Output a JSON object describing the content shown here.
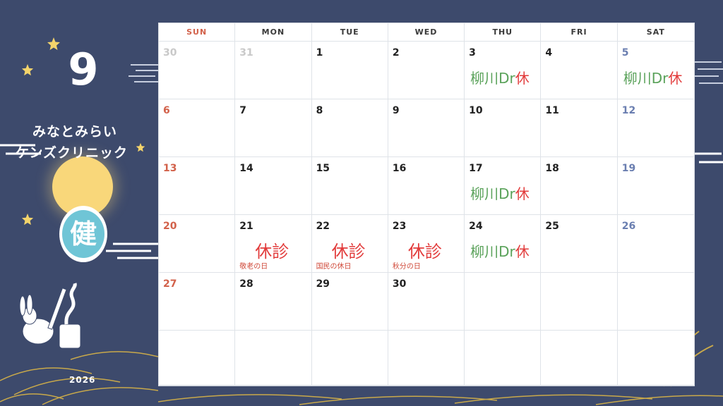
{
  "month": "9",
  "clinic_line1": "みなとみらい",
  "clinic_line2": "ケンズクリニック",
  "year": "2026",
  "badge_char": "健",
  "weekdays": [
    "SUN",
    "MON",
    "TUE",
    "WED",
    "THU",
    "FRI",
    "SAT"
  ],
  "dr_off_label": "柳川Dr",
  "dr_off_suffix": "休",
  "closed_label": "休診",
  "days": [
    {
      "num": "30",
      "muted": true
    },
    {
      "num": "31",
      "muted": true
    },
    {
      "num": "1"
    },
    {
      "num": "2"
    },
    {
      "num": "3",
      "dr_off": true
    },
    {
      "num": "4"
    },
    {
      "num": "5",
      "dr_off": true
    },
    {
      "num": "6"
    },
    {
      "num": "7"
    },
    {
      "num": "8"
    },
    {
      "num": "9"
    },
    {
      "num": "10"
    },
    {
      "num": "11"
    },
    {
      "num": "12"
    },
    {
      "num": "13"
    },
    {
      "num": "14"
    },
    {
      "num": "15"
    },
    {
      "num": "16"
    },
    {
      "num": "17",
      "dr_off": true
    },
    {
      "num": "18"
    },
    {
      "num": "19"
    },
    {
      "num": "20"
    },
    {
      "num": "21",
      "closed": true,
      "holiday": "敬老の日"
    },
    {
      "num": "22",
      "closed": true,
      "holiday": "国民の休日"
    },
    {
      "num": "23",
      "closed": true,
      "holiday": "秋分の日"
    },
    {
      "num": "24",
      "dr_off": true
    },
    {
      "num": "25"
    },
    {
      "num": "26"
    },
    {
      "num": "27"
    },
    {
      "num": "28"
    },
    {
      "num": "29"
    },
    {
      "num": "30"
    },
    {
      "num": ""
    },
    {
      "num": ""
    },
    {
      "num": ""
    },
    {
      "num": ""
    },
    {
      "num": ""
    },
    {
      "num": ""
    },
    {
      "num": ""
    },
    {
      "num": ""
    },
    {
      "num": ""
    },
    {
      "num": ""
    }
  ],
  "colors": {
    "background": "#3d4a6c",
    "sunday": "#d2614a",
    "saturday": "#6a7eb0",
    "dr_off_green": "#5aa25a",
    "closed_red": "#e23b3b",
    "moon": "#f9d77a",
    "badge": "#6fc5d6"
  }
}
